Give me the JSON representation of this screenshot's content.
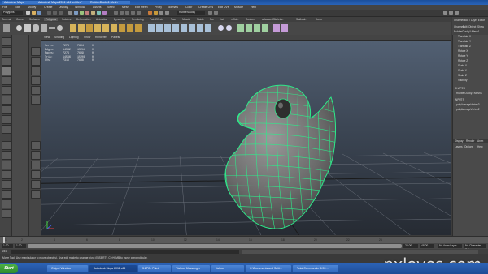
{
  "window": {
    "title_tabs": [
      "Autodesk Maya",
      "Autodesk Maya 2011 x64 untitled*",
      "RubberDucky1:Mesh"
    ]
  },
  "menubar": {
    "items": [
      "File",
      "Edit",
      "Modify",
      "Create",
      "Display",
      "Window",
      "Assets",
      "Select",
      "Mesh",
      "Edit Mesh",
      "Proxy",
      "Normals",
      "Color",
      "Create UVs",
      "Edit UVs",
      "Muscle",
      "Help"
    ]
  },
  "statusline": {
    "mode": "Polygons",
    "object": "RubberDucky"
  },
  "shelf": {
    "tabs": [
      "General",
      "Curves",
      "Surfaces",
      "Polygons",
      "Subdivs",
      "Deformation",
      "Animation",
      "Dynamics",
      "Rendering",
      "PaintEffects",
      "Toon",
      "Muscle",
      "Fluids",
      "Fur",
      "Hair",
      "nCloth",
      "Custom",
      "advancedSkeleton",
      "Sjalhash",
      "Kurve"
    ],
    "selected_tab": "Polygons"
  },
  "viewport": {
    "menu": [
      "View",
      "Shading",
      "Lighting",
      "Show",
      "Renderer",
      "Panels"
    ],
    "hud": [
      {
        "label": "Verts:",
        "a": "7274",
        "b": "7604",
        "c": "0"
      },
      {
        "label": "Edges:",
        "a": "14542",
        "b": "15211",
        "c": "0"
      },
      {
        "label": "Faces:",
        "a": "7274",
        "b": "7609",
        "c": "0"
      },
      {
        "label": "Tris:",
        "a": "14536",
        "b": "15208",
        "c": "0"
      },
      {
        "label": "UVs:",
        "a": "7316",
        "b": "7688",
        "c": "0"
      }
    ],
    "wire_color": "#2eea8a"
  },
  "channelbox": {
    "header": "Channel Box / Layer Editor",
    "tabs": [
      "Channels",
      "Edit",
      "Object",
      "Show"
    ],
    "object": "RubberDucky1:Mesh1",
    "attrs": [
      "Translate X",
      "Translate Y",
      "Translate Z",
      "Rotate X",
      "Rotate Y",
      "Rotate Z",
      "Scale X",
      "Scale Y",
      "Scale Z",
      "Visibility"
    ],
    "shapes_label": "SHAPES",
    "shape_name": "RubberDucky1:MeshS",
    "inputs_label": "INPUTS",
    "inputs": [
      "polyAverageVertex3",
      "polyAverageVertex2"
    ],
    "layer_tabs": [
      "Display",
      "Render",
      "Anim"
    ],
    "layer_menu": [
      "Layers",
      "Options",
      "Help"
    ]
  },
  "timeline": {
    "ticks": [
      "1",
      "2",
      "4",
      "6",
      "8",
      "10",
      "12",
      "14",
      "16",
      "18",
      "20",
      "22",
      "24"
    ]
  },
  "range": {
    "start": "1.00",
    "start2": "1.00",
    "end": "24.00",
    "end2": "48.00",
    "anim_layer": "No Anim Layer",
    "char_set": "No Character Set"
  },
  "commandline": {
    "label": "MEL"
  },
  "help": {
    "text": "Move Tool: Use manipulator to move object(s). Use edit mode to change pivot (INSERT). Ctrl+LMB to move perpendicular."
  },
  "taskbar": {
    "start": "Start",
    "buttons": [
      "Output Window",
      "Autodesk Maya 2011 x64",
      "3.2P2 - Paint",
      "Yahoo! Messenger",
      "Yahoo!",
      "C:\\Documents and Setti...",
      "Total Commander 6.53 ..."
    ]
  },
  "watermark": "pxleyes.com"
}
